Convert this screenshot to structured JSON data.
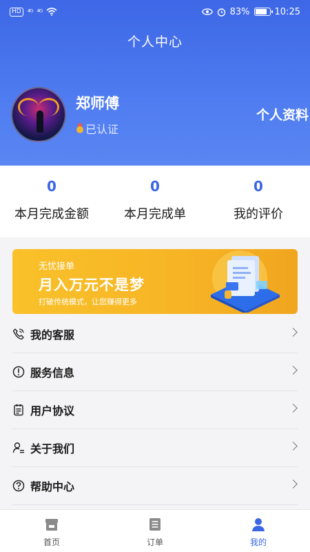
{
  "status_bar": {
    "chip": "HD",
    "signal1": "⁴ᴳ",
    "signal2": "⁴ᴳ",
    "battery": "83%",
    "battery_level": 0.83,
    "time": "10:25"
  },
  "header": {
    "title": "个人中心",
    "user_name": "郑师傅",
    "verified": "已认证",
    "profile_link": "个人资料"
  },
  "stats": [
    {
      "value": "0",
      "label": "本月完成金额"
    },
    {
      "value": "0",
      "label": "本月完成单"
    },
    {
      "value": "0",
      "label": "我的评价"
    }
  ],
  "banner": {
    "small": "无忧接单",
    "big": "月入万元不是梦",
    "sub": "打破传统模式，让您赚得更多"
  },
  "menu": [
    {
      "label": "我的客服",
      "icon": "customer-service-icon"
    },
    {
      "label": "服务信息",
      "icon": "info-icon"
    },
    {
      "label": "用户协议",
      "icon": "agreement-icon"
    },
    {
      "label": "关于我们",
      "icon": "about-icon"
    },
    {
      "label": "帮助中心",
      "icon": "help-icon"
    }
  ],
  "tabbar": [
    {
      "label": "首页",
      "icon": "home-icon"
    },
    {
      "label": "订单",
      "icon": "order-icon"
    },
    {
      "label": "我的",
      "icon": "user-icon",
      "active": true
    }
  ],
  "colors": {
    "accent": "#3a66e4",
    "banner": "#f7b425"
  }
}
